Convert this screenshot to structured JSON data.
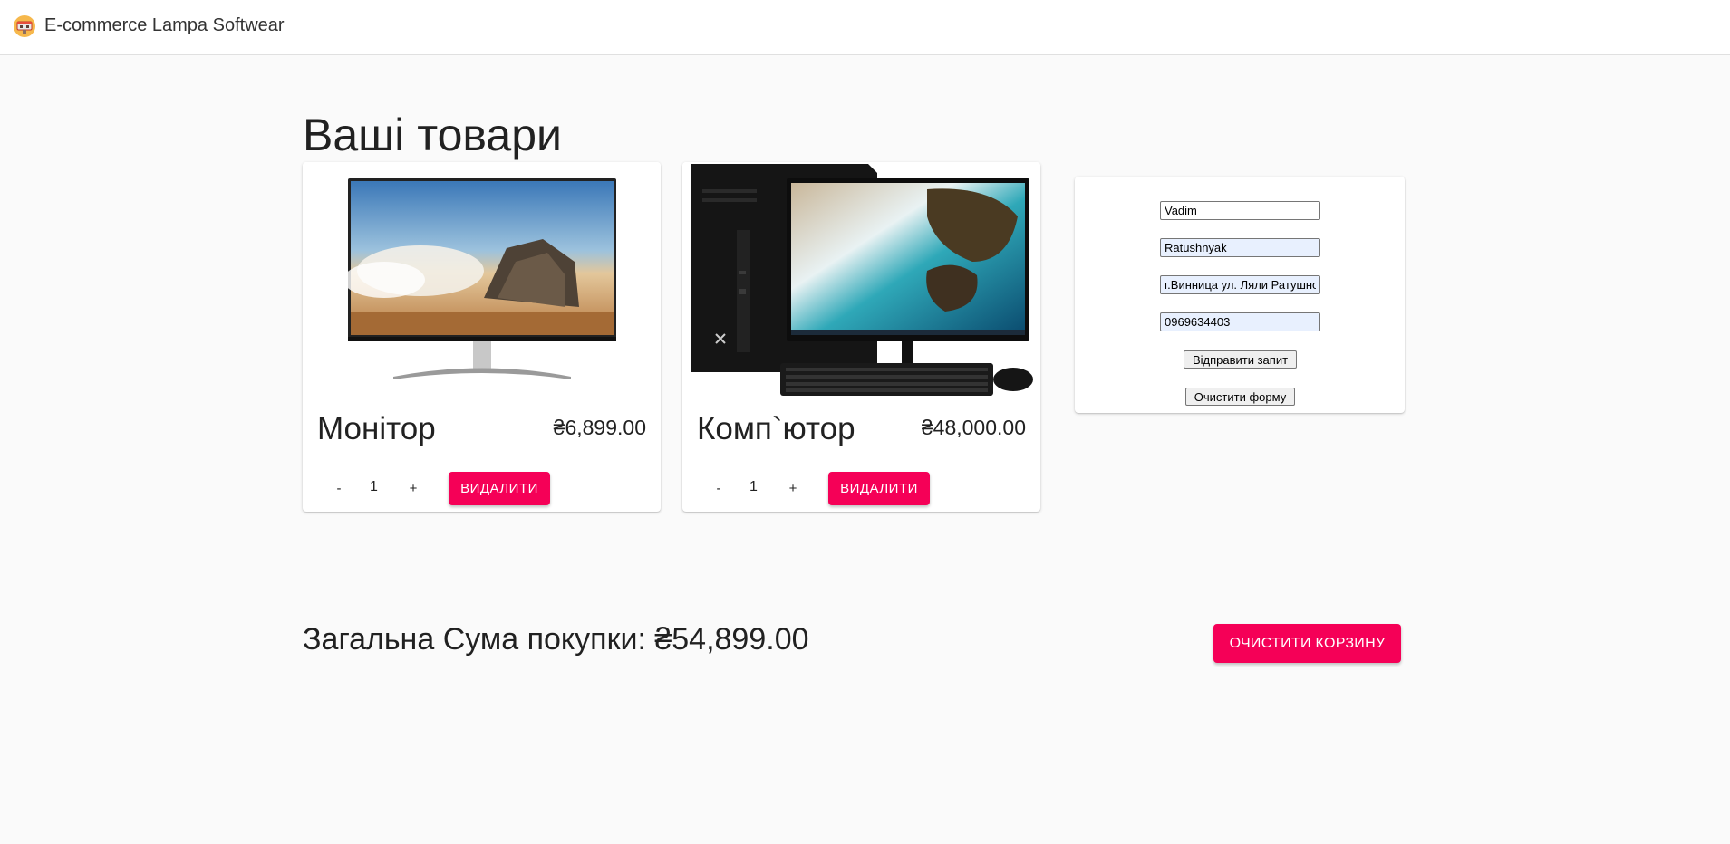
{
  "header": {
    "logo_icon": "lamp-logo-icon",
    "title": "E-commerce Lampa Softwear"
  },
  "page": {
    "title": "Ваші товари"
  },
  "products": [
    {
      "name": "Монітор",
      "price": "₴6,899.00",
      "quantity": "1",
      "minus_label": "-",
      "plus_label": "+",
      "delete_label": "ВИДАЛИТИ",
      "image_icon": "monitor-image"
    },
    {
      "name": "Комп`ютор",
      "price": "₴48,000.00",
      "quantity": "1",
      "minus_label": "-",
      "plus_label": "+",
      "delete_label": "ВИДАЛИТИ",
      "image_icon": "computer-image"
    }
  ],
  "order_form": {
    "first_name": "Vadim",
    "last_name": "Ratushnyak",
    "address": "г.Винница ул. Ляли Ратушной",
    "phone": "0969634403",
    "submit_label": "Відправити запит",
    "reset_label": "Очистити форму"
  },
  "summary": {
    "total_text": "Загальна Сума покупки: ₴54,899.00",
    "clear_cart_label": "ОЧИСТИТИ КОРЗИНУ"
  },
  "colors": {
    "accent": "#f50057",
    "background": "#fafafa",
    "card": "#ffffff",
    "autofill": "#e8f0fe"
  }
}
